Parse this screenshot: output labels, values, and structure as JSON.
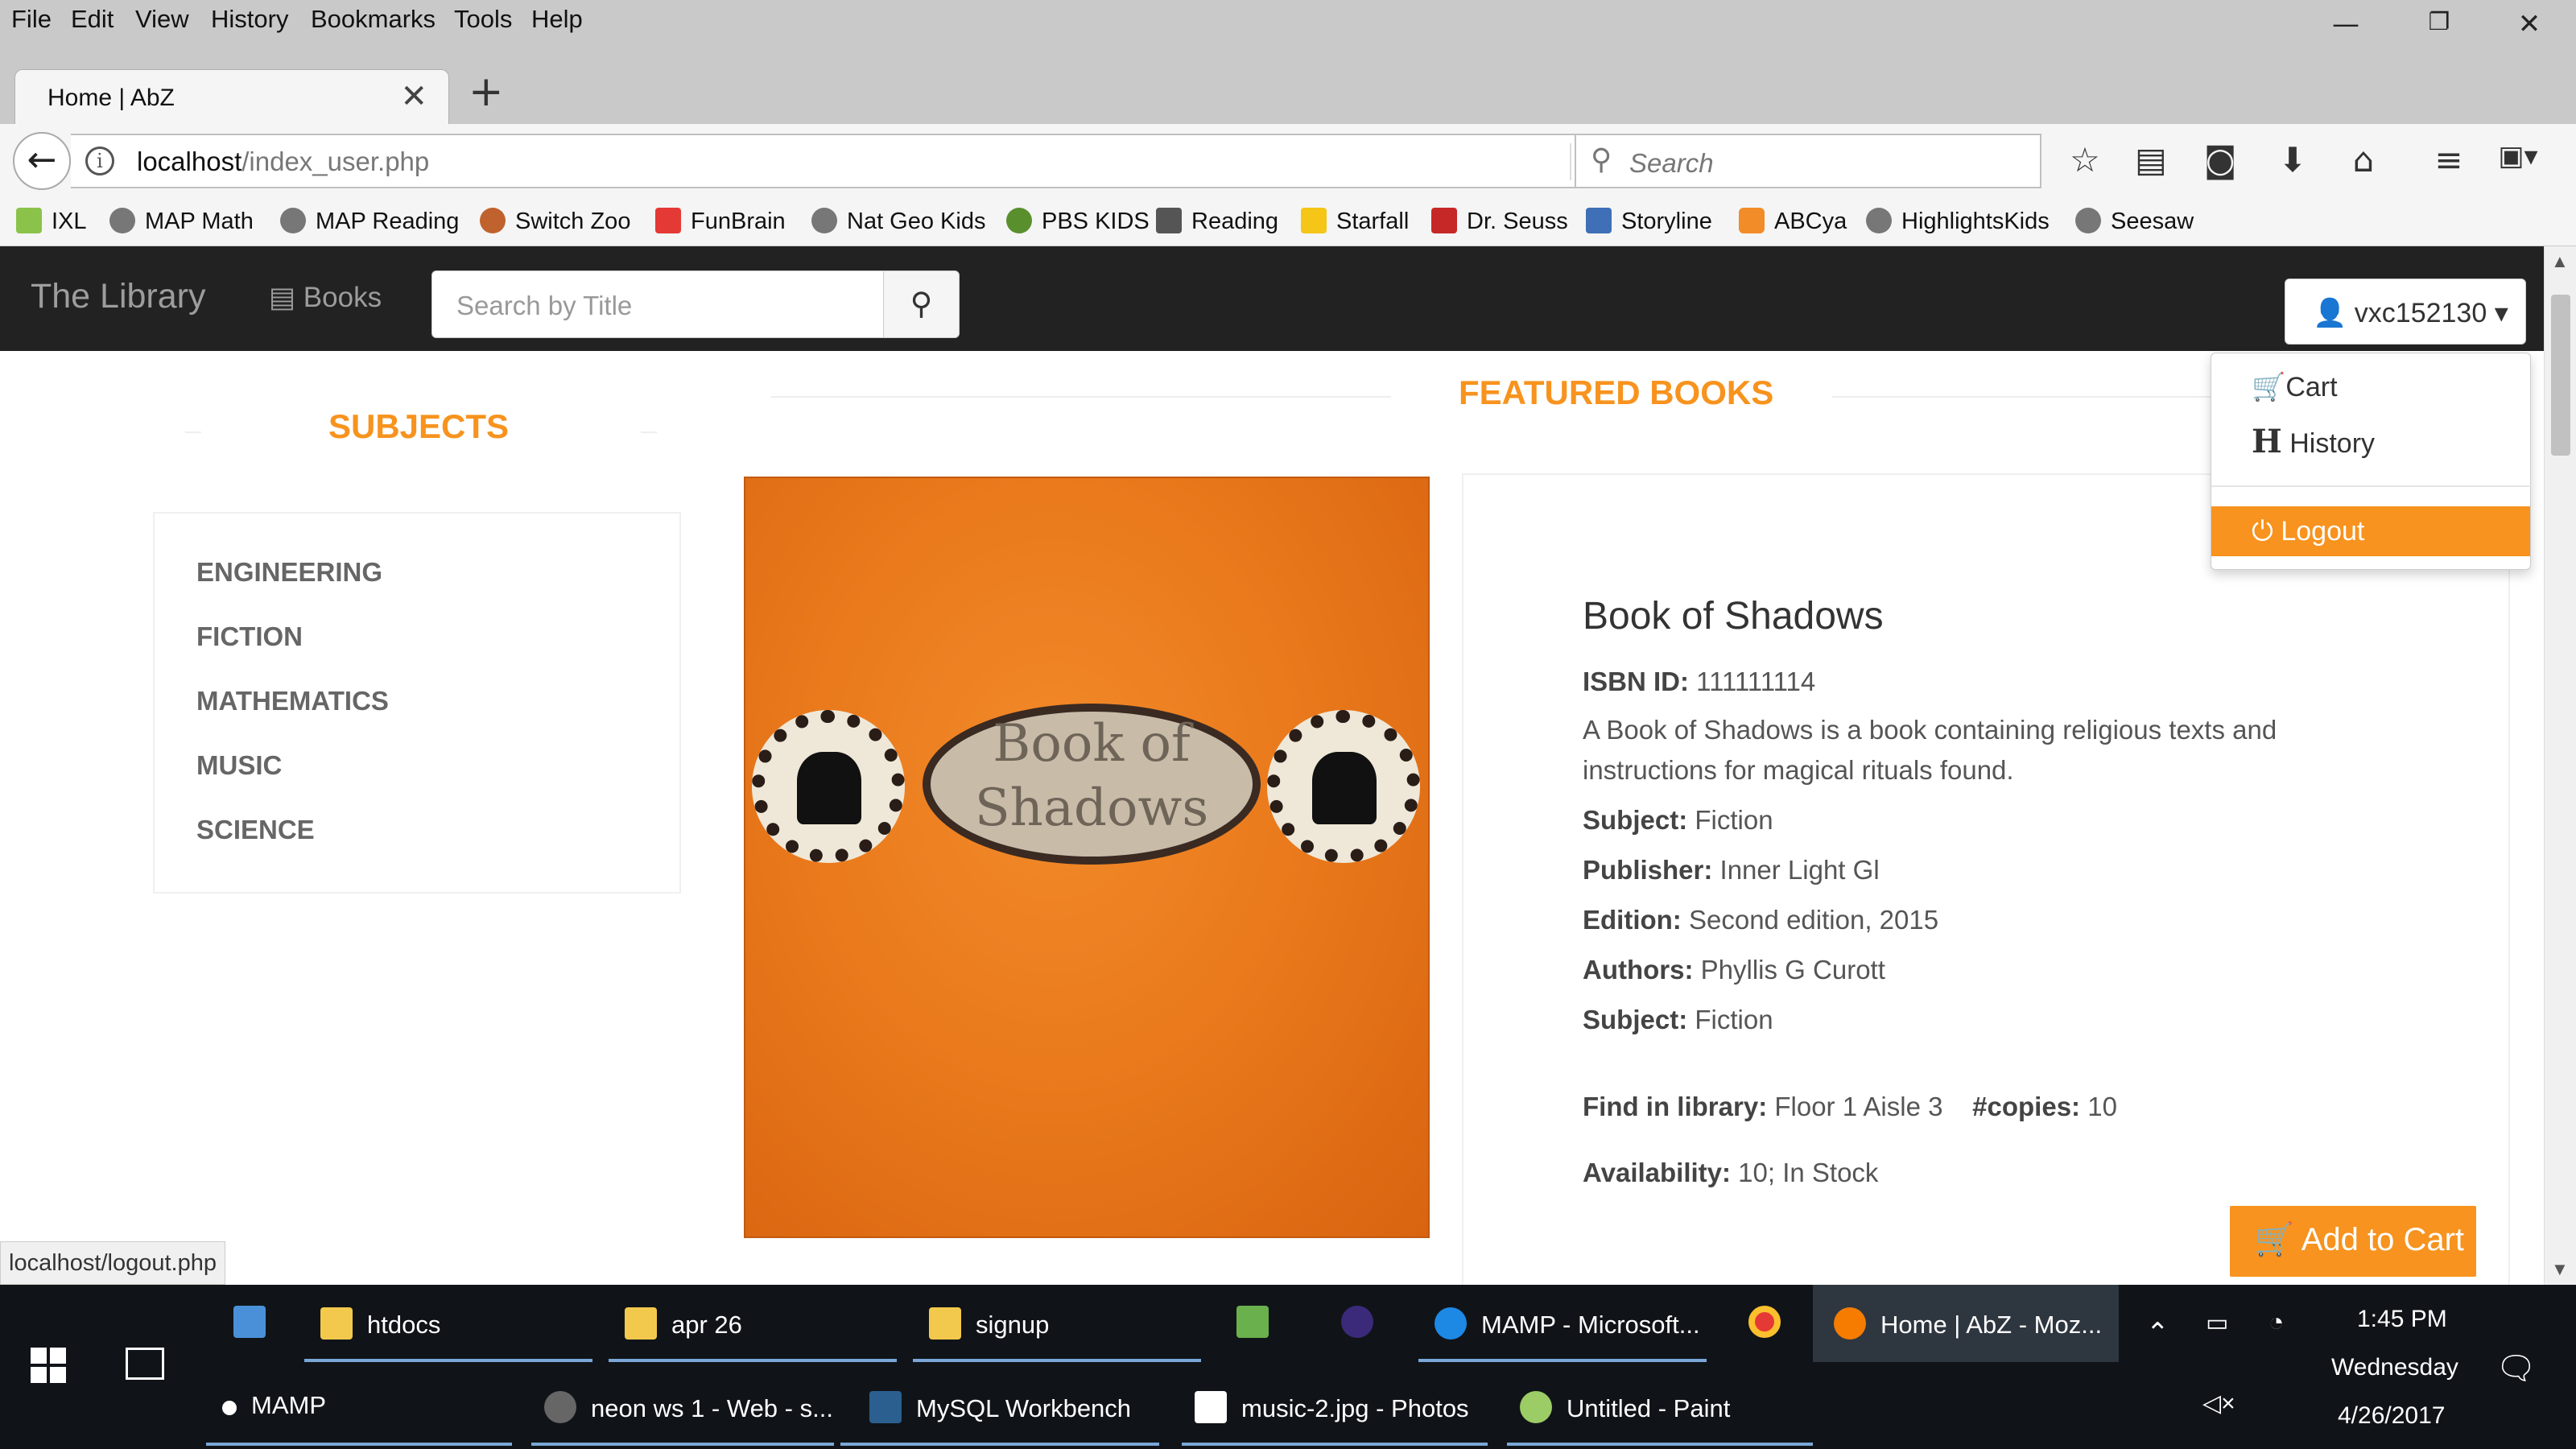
{
  "browser": {
    "menu": [
      "File",
      "Edit",
      "View",
      "History",
      "Bookmarks",
      "Tools",
      "Help"
    ],
    "tab_title": "Home | AbZ",
    "url_host": "localhost",
    "url_path": "/index_user.php",
    "search_placeholder": "Search",
    "bookmarks": [
      "IXL",
      "MAP Math",
      "MAP Reading",
      "Switch Zoo",
      "FunBrain",
      "Nat Geo Kids",
      "PBS KIDS",
      "Reading",
      "Starfall",
      "Dr. Seuss",
      "Storyline",
      "ABCya",
      "HighlightsKids",
      "Seesaw"
    ],
    "status_url": "localhost/logout.php"
  },
  "site": {
    "brand": "The Library",
    "books_link": "Books",
    "search_placeholder": "Search by Title",
    "user": "vxc152130",
    "user_menu": {
      "cart": "Cart",
      "history": "History",
      "logout": "Logout"
    }
  },
  "subjects": {
    "title": "SUBJECTS",
    "items": [
      "ENGINEERING",
      "FICTION",
      "MATHEMATICS",
      "MUSIC",
      "SCIENCE"
    ]
  },
  "featured": {
    "title": "FEATURED BOOKS",
    "cover_text": "Book of Shadows",
    "book": {
      "title": "Book of Shadows",
      "isbn_label": "ISBN ID:",
      "isbn": "111111114",
      "description_line1": "A Book of Shadows is a book containing religious texts and",
      "description_line2": "instructions for magical rituals found.",
      "subject_label": "Subject:",
      "subject": "Fiction",
      "publisher_label": "Publisher:",
      "publisher": "Inner Light Gl",
      "edition_label": "Edition:",
      "edition": "Second edition, 2015",
      "authors_label": "Authors:",
      "authors": "Phyllis G Curott",
      "find_label": "Find in library:",
      "location": "Floor 1 Aisle 3",
      "copies_label": "#copies:",
      "copies": "10",
      "availability_label": "Availability:",
      "availability": "10; In Stock"
    },
    "add_to_cart": "Add to Cart"
  },
  "taskbar": {
    "row1": [
      "htdocs",
      "apr 26",
      "signup",
      "MAMP - Microsoft...",
      "Home | AbZ - Moz..."
    ],
    "row2": [
      "MAMP",
      "neon ws 1 - Web - s...",
      "MySQL Workbench",
      "music-2.jpg - Photos",
      "Untitled - Paint"
    ],
    "time": "1:45 PM",
    "day": "Wednesday",
    "date": "4/26/2017"
  },
  "colors": {
    "accent": "#f7931e",
    "navbar": "#222222"
  }
}
